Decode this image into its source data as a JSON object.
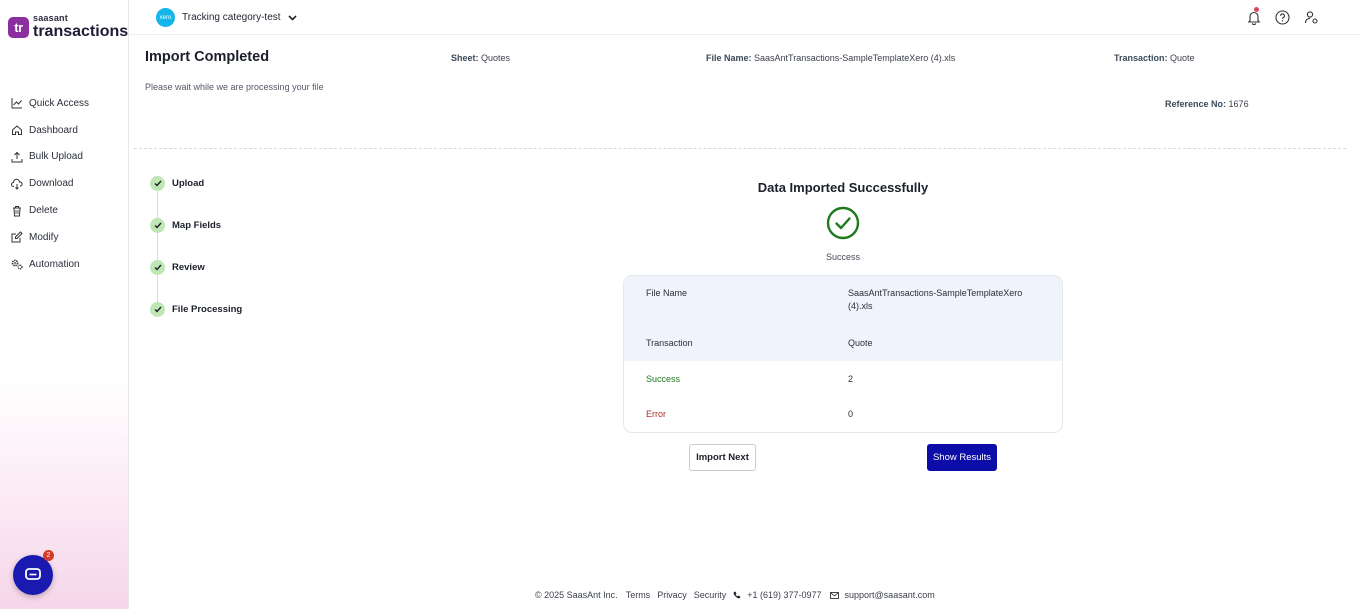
{
  "brand": {
    "logo_mark": "tr",
    "logo_small": "saasant",
    "logo_big": "transactions"
  },
  "sidebar": {
    "items": [
      {
        "label": "Quick Access",
        "icon": "chart-line-icon"
      },
      {
        "label": "Dashboard",
        "icon": "home-icon"
      },
      {
        "label": "Bulk Upload",
        "icon": "upload-icon"
      },
      {
        "label": "Download",
        "icon": "cloud-download-icon"
      },
      {
        "label": "Delete",
        "icon": "trash-icon"
      },
      {
        "label": "Modify",
        "icon": "edit-icon"
      },
      {
        "label": "Automation",
        "icon": "gears-icon"
      }
    ],
    "chat_badge": "2"
  },
  "topbar": {
    "org_badge": "xero",
    "org_name": "Tracking category-test"
  },
  "header": {
    "title": "Import Completed",
    "subtitle": "Please wait while we are processing your file",
    "sheet_label": "Sheet:",
    "sheet_value": "Quotes",
    "file_label": "File Name:",
    "file_value": "SaasAntTransactions-SampleTemplateXero (4).xls",
    "transaction_label": "Transaction:",
    "transaction_value": "Quote",
    "ref_label": "Reference No:",
    "ref_value": "1676"
  },
  "steps": [
    {
      "label": "Upload"
    },
    {
      "label": "Map Fields"
    },
    {
      "label": "Review"
    },
    {
      "label": "File Processing"
    }
  ],
  "result": {
    "title": "Data Imported Successfully",
    "status": "Success",
    "file_name_label": "File Name",
    "file_name_value_1": "SaasAntTransactions-SampleTemplateXero",
    "file_name_value_2": "(4).xls",
    "transaction_label": "Transaction",
    "transaction_value": "Quote",
    "success_label": "Success",
    "success_value": "2",
    "error_label": "Error",
    "error_value": "0"
  },
  "buttons": {
    "import_next": "Import Next",
    "show_results": "Show Results"
  },
  "footer": {
    "copyright": "© 2025 SaasAnt Inc.",
    "terms": "Terms",
    "privacy": "Privacy",
    "security": "Security",
    "phone": "+1 (619) 377-0977",
    "email": "support@saasant.com"
  },
  "colors": {
    "accent": "#0c0ca8",
    "success": "#1f7a1f",
    "error": "#a83228",
    "logo": "#8b2ea0"
  }
}
